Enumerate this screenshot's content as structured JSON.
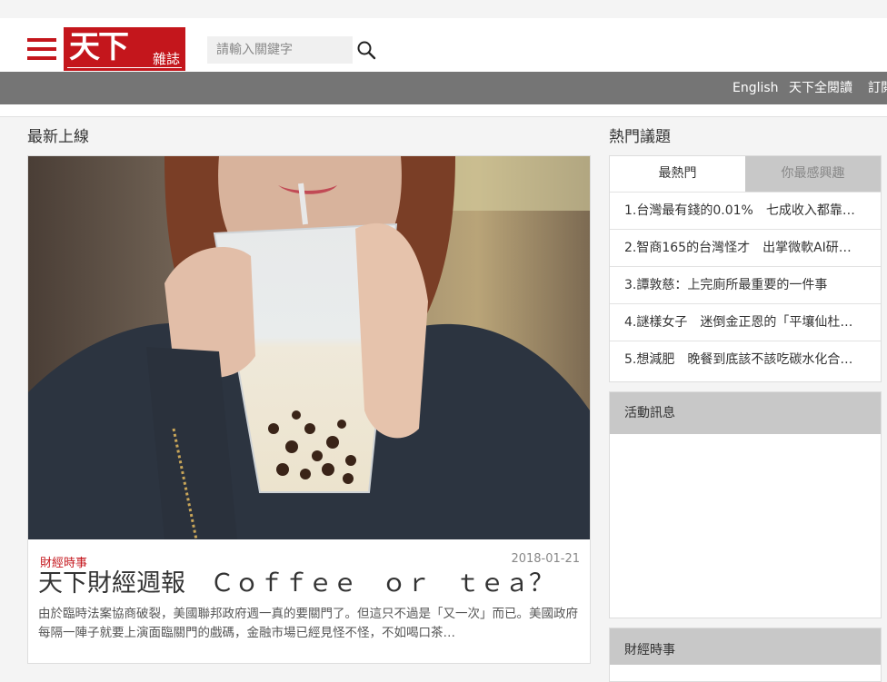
{
  "header": {
    "logo_main": "天下",
    "logo_sub": "雜誌",
    "search_placeholder": "請輸入關鍵字"
  },
  "nav": {
    "items": [
      "English",
      "天下全閱讀",
      "訂閱"
    ]
  },
  "latest": {
    "section_title": "最新上線",
    "article": {
      "category": "財經時事",
      "date": "2018-01-21",
      "title": "天下財經週報　Ｃｏｆｆｅｅ　ｏｒ　ｔｅａ？",
      "excerpt": "由於臨時法案協商破裂，美國聯邦政府週一真的要關門了。但這只不過是「又一次」而已。美國政府每隔一陣子就要上演面臨關門的戲碼，金融市場已經見怪不怪，不如喝口茶…"
    }
  },
  "hot": {
    "section_title": "熱門議題",
    "tabs": [
      "最熱門",
      "你最感興趣"
    ],
    "items": [
      "1.台灣最有錢的0.01%　七成收入都靠…",
      "2.智商165的台灣怪才　出掌微軟AI研…",
      "3.譚敦慈：上完廁所最重要的一件事",
      "4.謎樣女子　迷倒金正恩的「平壤仙杜…",
      "5.想減肥　晚餐到底該不該吃碳水化合…"
    ]
  },
  "events": {
    "title": "活動訊息"
  },
  "finance": {
    "title": "財經時事"
  },
  "colors": {
    "brand_red": "#c4161c",
    "nav_gray": "#757575",
    "panel_gray": "#c8c8c8"
  }
}
